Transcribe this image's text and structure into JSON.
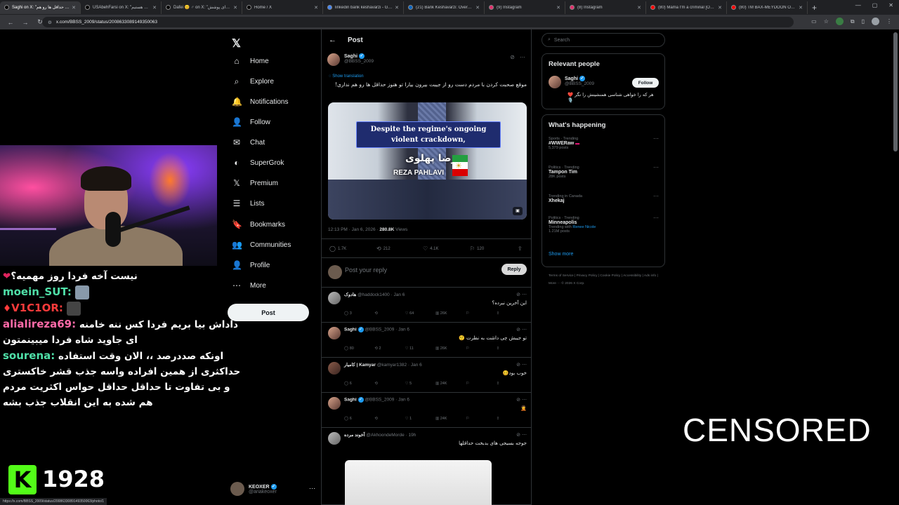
{
  "browser": {
    "tabs": [
      {
        "title": "Saghi on X: \"نداری حداقل ها رو هم...\"",
        "color": "#000000",
        "active": true
      },
      {
        "title": "USAbehFarsi on X: \"نام هستیم...\"",
        "color": "#000000"
      },
      {
        "title": "Dafei 😊 ♂ on X: \"رای پوشش...\"",
        "color": "#000000"
      },
      {
        "title": "Home / X",
        "color": "#000000"
      },
      {
        "title": "linkedin bank keshavarzi - Go...",
        "color": "#4285f4"
      },
      {
        "title": "(21) Bank Keshavarzi: Overvie...",
        "color": "#0a66c2"
      },
      {
        "title": "(9) Instagram",
        "color": "#e1306c"
      },
      {
        "title": "(8) Instagram",
        "color": "#e1306c"
      },
      {
        "title": "(80) Mama I'm a criminal [OFF...",
        "color": "#ff0000"
      },
      {
        "title": "(80) TM BAX-MEYDOON OFFI...",
        "color": "#ff0000"
      }
    ],
    "url": "x.com/BBSS_2009/status/2008633089149350063",
    "status_url": "https://x.com/BBSS_2009/status/2008633089149350063/photo/1"
  },
  "stream": {
    "chat": [
      {
        "user": "",
        "text": "نیست آخه فردا روز مهمیه؟",
        "heart": "❤"
      },
      {
        "user": "moein_SUT:",
        "user_color": "#4fe0a8",
        "text": "",
        "emote": true
      },
      {
        "user": "V1C1OR:",
        "user_color": "#ff3b3b",
        "badge": "♦",
        "text": "",
        "emote": true
      },
      {
        "user": "alialireza69:",
        "user_color": "#ff6aa8",
        "text": "داداش بیا بریم فردا کس ننه خامنه ای جاوید شاه فردا میبینمتون"
      },
      {
        "user": "sourena:",
        "user_color": "#4fe0a8",
        "text": "اونکه صددرصد ،، الان وقت استفاده حداکثری از همین افراده واسه جذب قشر خاکستری و بی تفاوت تا حداقل حداقل حواس اکثریت مردم هم شده به این انقلاب جذب بشه"
      }
    ],
    "kick_logo": "K",
    "viewer_count": "1928"
  },
  "xnav": {
    "logo": "𝕏",
    "items": [
      {
        "label": "Home",
        "icon": "⌂"
      },
      {
        "label": "Explore",
        "icon": "⌕"
      },
      {
        "label": "Notifications",
        "icon": "🔔"
      },
      {
        "label": "Follow",
        "icon": "👤"
      },
      {
        "label": "Chat",
        "icon": "✉"
      },
      {
        "label": "SuperGrok",
        "icon": "◐"
      },
      {
        "label": "Premium",
        "icon": "𝕏"
      },
      {
        "label": "Lists",
        "icon": "☰"
      },
      {
        "label": "Bookmarks",
        "icon": "🔖"
      },
      {
        "label": "Communities",
        "icon": "👥"
      },
      {
        "label": "Profile",
        "icon": "👤"
      },
      {
        "label": "More",
        "icon": "⋯"
      }
    ],
    "post_label": "Post",
    "account": {
      "name": "KEOXER",
      "handle": "@ariakeoxer"
    }
  },
  "post": {
    "header_title": "Post",
    "author_name": "Saghi",
    "author_handle": "@BBSS_2009",
    "show_translation": "Show translation",
    "text": "موقع صحبت کردن با مردم دست رو از جیبت بیرون بیارا تو هنوز حداقل ها رو هم نداری!",
    "media_caption": "Despite the regime's ongoing violent crackdown,",
    "media_name_fa": "رضا پهلوی",
    "media_name_en": "REZA PAHLAVI",
    "time": "12:13 PM · Jan 6, 2026 ·",
    "views_count": "280.8K",
    "views_label": "Views",
    "stats": {
      "replies": "1.7K",
      "reposts": "212",
      "likes": "4.1K",
      "bookmarks": "120"
    },
    "reply_placeholder": "Post your reply",
    "reply_button": "Reply"
  },
  "replies": [
    {
      "name": "هادوک",
      "handle": "@haddock1400 · Jan 6",
      "text": "این آخرین نبرده؟",
      "stats": [
        "3",
        "",
        "64",
        "26K",
        "",
        ""
      ]
    },
    {
      "name": "Saghi",
      "handle": "@BBSS_2009 · Jan 6",
      "text": "تو جیبش چی داشت به نظرت 🤨",
      "stats": [
        "80",
        "2",
        "11",
        "26K",
        "",
        ""
      ],
      "verified": true
    },
    {
      "name": "کامیار | Kamyar",
      "handle": "@kamyar1382 · Jan 6",
      "text": "خوب بود🥴",
      "stats": [
        "6",
        "",
        "5",
        "24K",
        "",
        ""
      ]
    },
    {
      "name": "Saghi",
      "handle": "@BBSS_2009 · Jan 6",
      "text": "🤦",
      "stats": [
        "6",
        "",
        "1",
        "24K",
        "",
        ""
      ],
      "verified": true
    },
    {
      "name": "آخوند مرده",
      "handle": "@AkhoondeMorde · 19h",
      "text": "جوجه بسیجی های بدبخت حداقلها",
      "stats": []
    }
  ],
  "right": {
    "search_placeholder": "Search",
    "relevant_title": "Relevant people",
    "relevant": {
      "name": "Saghi",
      "handle": "@BBSS_2009",
      "follow": "Follow",
      "bio": "هر که را خواهی شناسی همنشینش را نگر ❤️ 🎙️"
    },
    "happening_title": "What's happening",
    "trends": [
      {
        "category": "Sports · Trending",
        "name": "#WWERaw",
        "count": "5,379 posts",
        "live": true
      },
      {
        "category": "Politics · Trending",
        "name": "Tampon Tim",
        "count": "28K posts"
      },
      {
        "category": "Trending in Canada",
        "name": "Xhekaj",
        "count": ""
      },
      {
        "category": "Politics · Trending",
        "name": "Minneapolis",
        "with_label": "Trending with",
        "with": "Renee Nicole",
        "count": "1.21M posts"
      }
    ],
    "show_more": "Show more",
    "footer": "Terms of Service | Privacy Policy | Cookie Policy | Accessibility | Ads info | More ··· © 2026 X Corp."
  },
  "overlay": {
    "censored": "CENSORED"
  }
}
